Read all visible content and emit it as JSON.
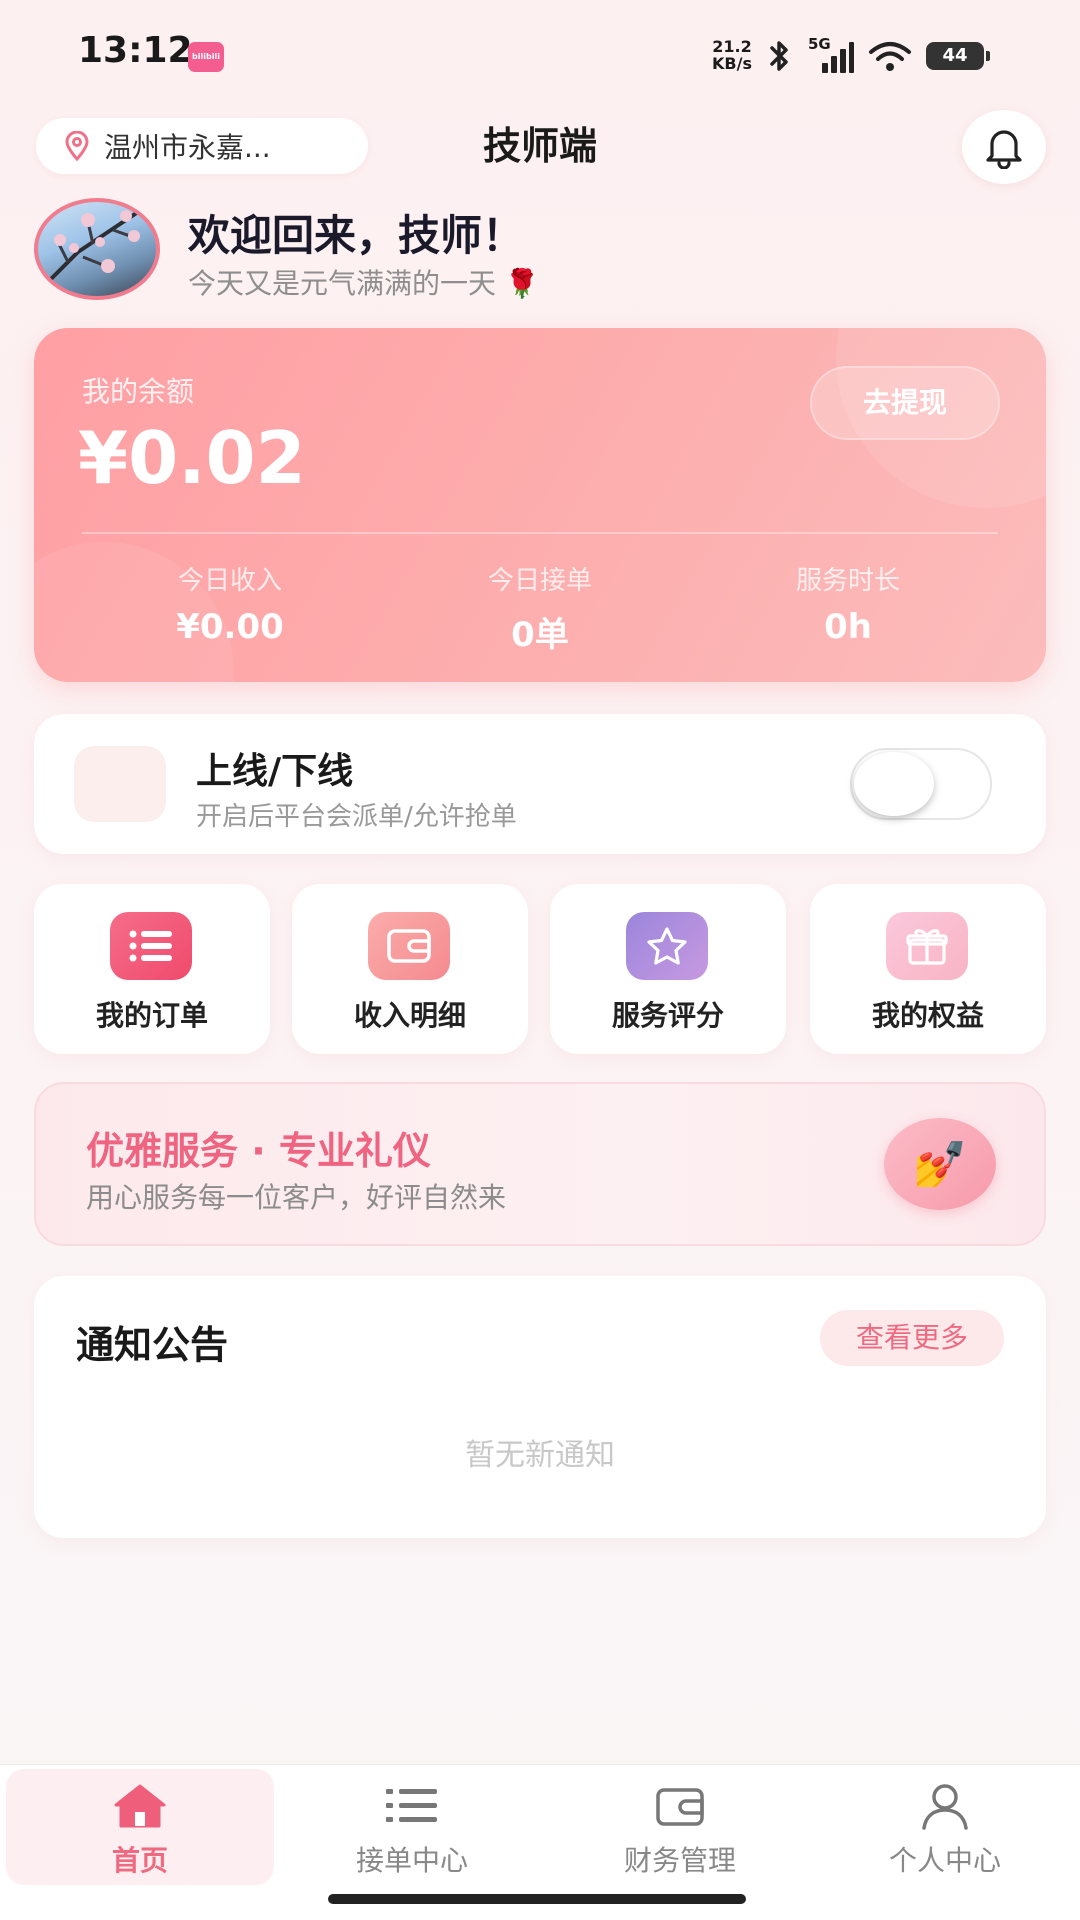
{
  "status_bar": {
    "time": "13:12",
    "app_badge": "bilibili",
    "net_speed_value": "21.2",
    "net_speed_unit": "KB/s",
    "network_type": "5G",
    "battery": "44"
  },
  "header": {
    "location": "温州市永嘉...",
    "title": "技师端"
  },
  "welcome": {
    "title": "欢迎回来，技师！",
    "subtitle": "今天又是元气满满的一天 🌹"
  },
  "balance": {
    "label": "我的余额",
    "amount": "¥0.02",
    "withdraw_label": "去提现",
    "stats": [
      {
        "label": "今日收入",
        "value": "¥0.00"
      },
      {
        "label": "今日接单",
        "value": "0单"
      },
      {
        "label": "服务时长",
        "value": "0h"
      }
    ]
  },
  "online": {
    "title": "上线/下线",
    "subtitle": "开启后平台会派单/允许抢单",
    "enabled": false
  },
  "quick_menu": [
    {
      "label": "我的订单",
      "icon": "list-icon",
      "color": "#f2577a"
    },
    {
      "label": "收入明细",
      "icon": "wallet-icon",
      "color": "#f68d92"
    },
    {
      "label": "服务评分",
      "icon": "star-icon",
      "color": "#a585d8"
    },
    {
      "label": "我的权益",
      "icon": "gift-icon",
      "color": "#f9b6c8"
    }
  ],
  "promo": {
    "title": "优雅服务 · 专业礼仪",
    "subtitle": "用心服务每一位客户，好评自然来",
    "icon": "💅"
  },
  "notice": {
    "title": "通知公告",
    "more_label": "查看更多",
    "empty_text": "暂无新通知"
  },
  "tabbar": [
    {
      "label": "首页",
      "icon": "home-icon",
      "active": true
    },
    {
      "label": "接单中心",
      "icon": "list-icon",
      "active": false
    },
    {
      "label": "财务管理",
      "icon": "wallet-icon",
      "active": false
    },
    {
      "label": "个人中心",
      "icon": "user-icon",
      "active": false
    }
  ],
  "colors": {
    "accent": "#ef6a80",
    "balance_card": "#fdaaad"
  }
}
